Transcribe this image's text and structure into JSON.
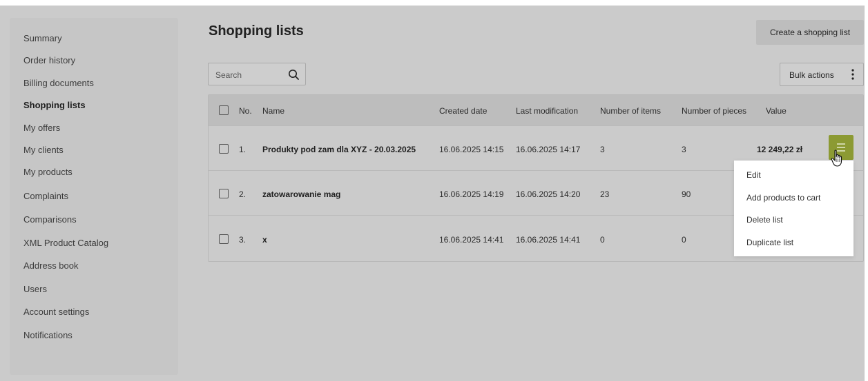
{
  "sidebar": {
    "items": [
      {
        "label": "Summary"
      },
      {
        "label": "Order history"
      },
      {
        "label": "Billing documents"
      },
      {
        "label": "Shopping lists",
        "active": true
      },
      {
        "label": "My offers"
      },
      {
        "label": "My clients"
      },
      {
        "label": "My products"
      },
      {
        "label": "Complaints"
      },
      {
        "label": "Comparisons"
      },
      {
        "label": "XML Product Catalog"
      },
      {
        "label": "Address book"
      },
      {
        "label": "Users"
      },
      {
        "label": "Account settings"
      },
      {
        "label": "Notifications"
      }
    ]
  },
  "header": {
    "title": "Shopping lists",
    "create_label": "Create a shopping list"
  },
  "toolbar": {
    "search_placeholder": "Search",
    "search_icon": "search-icon",
    "bulk_label": "Bulk actions",
    "bulk_icon": "vertical-dots-icon"
  },
  "table": {
    "columns": {
      "no": "No.",
      "name": "Name",
      "created": "Created date",
      "modified": "Last modification",
      "items": "Number of items",
      "pieces": "Number of pieces",
      "value": "Value"
    },
    "rows": [
      {
        "no": "1.",
        "name": "Produkty pod zam dla XYZ - 20.03.2025",
        "created": "16.06.2025 14:15",
        "modified": "16.06.2025 14:17",
        "items": "3",
        "pieces": "3",
        "value": "12 249,22 zł"
      },
      {
        "no": "2.",
        "name": "zatowarowanie mag",
        "created": "16.06.2025 14:19",
        "modified": "16.06.2025 14:20",
        "items": "23",
        "pieces": "90",
        "value": ""
      },
      {
        "no": "3.",
        "name": "x",
        "created": "16.06.2025 14:41",
        "modified": "16.06.2025 14:41",
        "items": "0",
        "pieces": "0",
        "value": ""
      }
    ]
  },
  "row_menu": {
    "icon": "hamburger-menu-icon",
    "accent_color": "#8c9a33",
    "items": [
      {
        "label": "Edit"
      },
      {
        "label": "Add products to cart"
      },
      {
        "label": "Delete list"
      },
      {
        "label": "Duplicate list"
      }
    ]
  }
}
